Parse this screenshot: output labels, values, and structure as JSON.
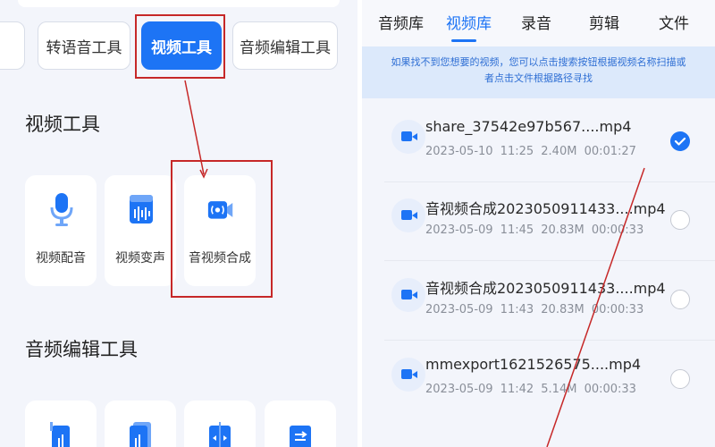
{
  "left": {
    "tabs": [
      {
        "label": "转语音工具",
        "active": false
      },
      {
        "label": "视频工具",
        "active": true
      },
      {
        "label": "音频编辑工具",
        "active": false
      }
    ],
    "section_video": "视频工具",
    "video_tools": [
      {
        "label": "视频配音",
        "icon": "microphone-icon"
      },
      {
        "label": "视频变声",
        "icon": "waveform-icon"
      },
      {
        "label": "音视频合成",
        "icon": "video-merge-icon"
      }
    ],
    "section_audio": "音频编辑工具",
    "audio_tools": [
      {
        "icon": "audio-cut-icon"
      },
      {
        "icon": "audio-merge-icon"
      },
      {
        "icon": "audio-split-icon"
      },
      {
        "icon": "audio-convert-icon"
      }
    ]
  },
  "right": {
    "tabs": [
      {
        "label": "音频库",
        "active": false
      },
      {
        "label": "视频库",
        "active": true
      },
      {
        "label": "录音",
        "active": false
      },
      {
        "label": "剪辑",
        "active": false
      },
      {
        "label": "文件",
        "active": false
      }
    ],
    "hint_line1": "如果找不到您想要的视频，您可以点击搜索按钮根据视频名称扫描或",
    "hint_line2": "者点击文件根据路径寻找",
    "files": [
      {
        "name": "share_37542e97b567....mp4",
        "meta": "2023-05-10 11:25  2.40M  00:01:27",
        "selected": true
      },
      {
        "name": "音视频合成2023050911433....mp4",
        "meta": "2023-05-09 11:45  20.83M  00:00:33",
        "selected": false
      },
      {
        "name": "音视频合成2023050911433....mp4",
        "meta": "2023-05-09 11:43  20.83M  00:00:33",
        "selected": false
      },
      {
        "name": "mmexport1621526575....mp4",
        "meta": "2023-05-09 11:42  5.14M  00:00:33",
        "selected": false
      }
    ],
    "accent": "#1d74f5"
  },
  "colors": {
    "accent": "#1d74f5",
    "annotation": "#c62828"
  }
}
